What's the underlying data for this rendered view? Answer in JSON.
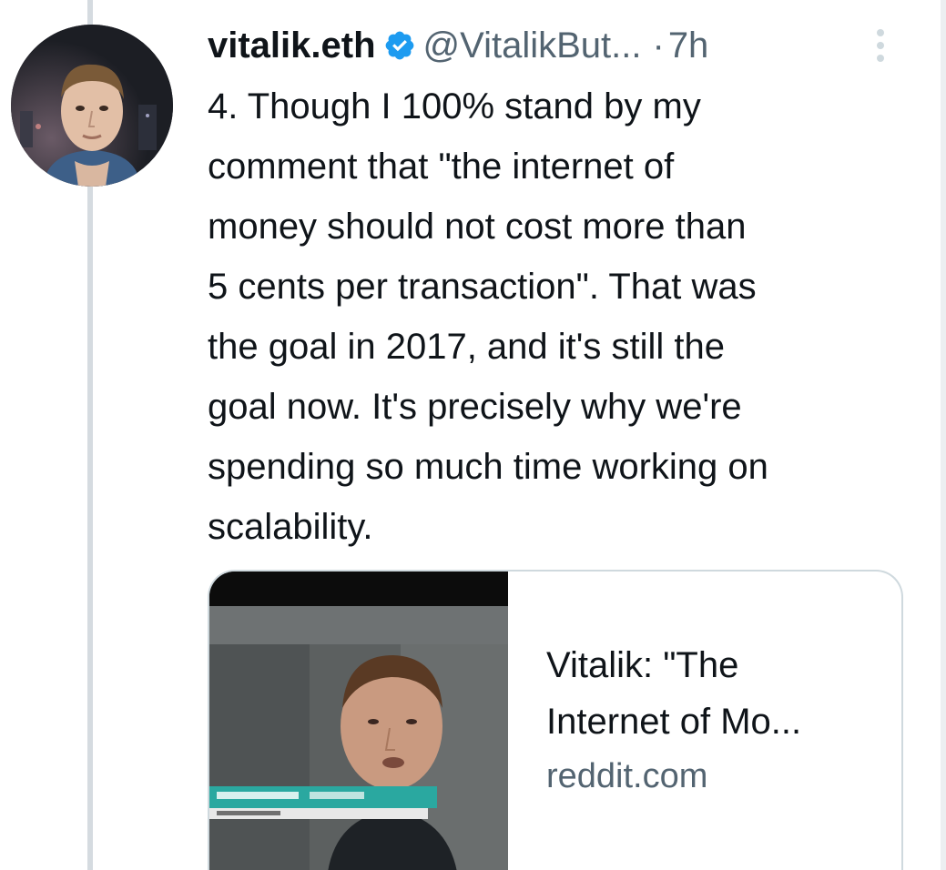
{
  "tweet": {
    "display_name": "vitalik.eth",
    "handle": "@VitalikBut...",
    "separator": "·",
    "time": "7h",
    "text": "4. Though I 100% stand by my\ncomment that \"the internet of\nmoney should not cost more than\n5 cents per transaction\". That was\nthe goal in 2017, and it's still the\ngoal now. It's precisely why we're\nspending so much time working on\nscalability."
  },
  "link_card": {
    "title_line1": "Vitalik: \"The",
    "title_line2": "Internet of Mo...",
    "domain": "reddit.com"
  },
  "icons": {
    "verified": "verified-badge-icon",
    "more": "more-vertical-icon"
  },
  "colors": {
    "verified_blue": "#1d9bf0",
    "secondary_text": "#536471",
    "primary_text": "#0f1419",
    "border": "#cfd9de"
  }
}
